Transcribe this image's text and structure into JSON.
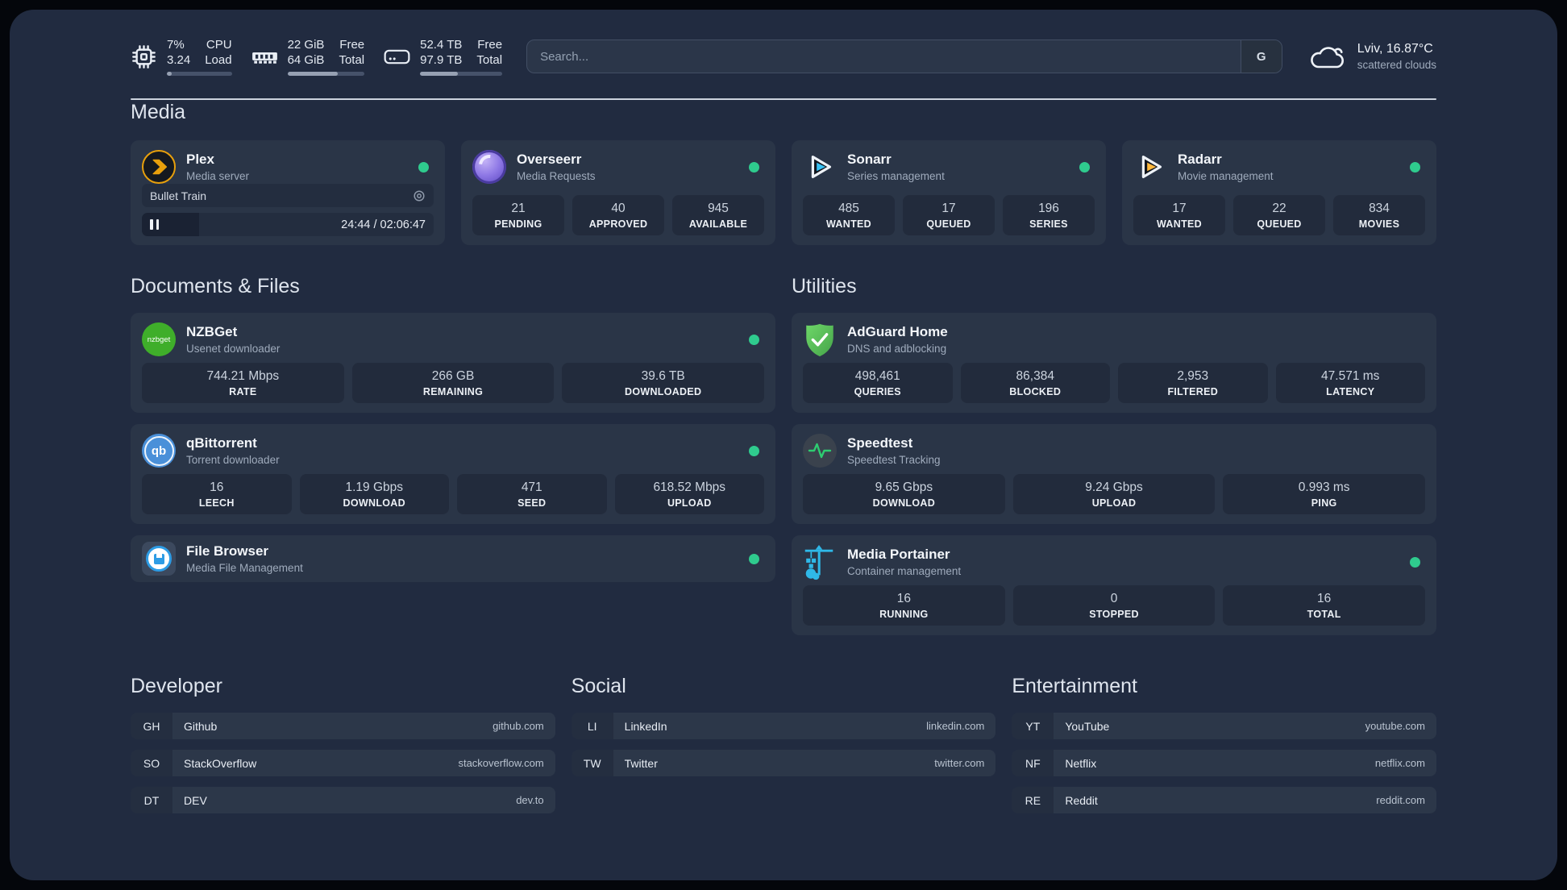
{
  "colors": {
    "panel_bg": "#212b40",
    "card_bg": "#2a3547",
    "stat_bg": "#222b3c",
    "status_online": "#2fcb8e",
    "plex_amber": "#e8a00c",
    "sonarr_blue": "#39c1f3",
    "radarr_yellow": "#ffb83d",
    "nzbget_green": "#3fae2a",
    "qbittorrent_blue": "#4a90d9",
    "adguard_green": "#5fce61",
    "portainer_blue": "#2fb8e8",
    "speedtest_pulse": "#2ecc71"
  },
  "topbar": {
    "cpu": {
      "value_top": "7%",
      "value_bottom": "3.24",
      "label_top": "CPU",
      "label_bottom": "Load",
      "bar_percent": 7
    },
    "memory": {
      "value_top": "22 GiB",
      "value_bottom": "64 GiB",
      "label_top": "Free",
      "label_bottom": "Total",
      "bar_percent": 65
    },
    "disk": {
      "value_top": "52.4 TB",
      "value_bottom": "97.9 TB",
      "label_top": "Free",
      "label_bottom": "Total",
      "bar_percent": 46
    },
    "search": {
      "placeholder": "Search...",
      "provider_label": "G"
    },
    "weather": {
      "location": "Lviv, 16.87°C",
      "condition": "scattered clouds"
    }
  },
  "sections": {
    "media": "Media",
    "documents": "Documents & Files",
    "utilities": "Utilities"
  },
  "apps": {
    "plex": {
      "name": "Plex",
      "desc": "Media server",
      "status": "online",
      "player": {
        "title": "Bullet Train",
        "time": "24:44 / 02:06:47",
        "progress_percent": 19.5
      }
    },
    "overseerr": {
      "name": "Overseerr",
      "desc": "Media Requests",
      "status": "online",
      "stats": [
        {
          "value": "21",
          "label": "PENDING"
        },
        {
          "value": "40",
          "label": "APPROVED"
        },
        {
          "value": "945",
          "label": "AVAILABLE"
        }
      ]
    },
    "sonarr": {
      "name": "Sonarr",
      "desc": "Series management",
      "status": "online",
      "stats": [
        {
          "value": "485",
          "label": "WANTED"
        },
        {
          "value": "17",
          "label": "QUEUED"
        },
        {
          "value": "196",
          "label": "SERIES"
        }
      ]
    },
    "radarr": {
      "name": "Radarr",
      "desc": "Movie management",
      "status": "online",
      "stats": [
        {
          "value": "17",
          "label": "WANTED"
        },
        {
          "value": "22",
          "label": "QUEUED"
        },
        {
          "value": "834",
          "label": "MOVIES"
        }
      ]
    },
    "nzbget": {
      "name": "NZBGet",
      "desc": "Usenet downloader",
      "status": "online",
      "icon_text": "nzbget",
      "stats": [
        {
          "value": "744.21 Mbps",
          "label": "RATE"
        },
        {
          "value": "266 GB",
          "label": "REMAINING"
        },
        {
          "value": "39.6 TB",
          "label": "DOWNLOADED"
        }
      ]
    },
    "qbittorrent": {
      "name": "qBittorrent",
      "desc": "Torrent downloader",
      "status": "online",
      "icon_text": "qb",
      "stats": [
        {
          "value": "16",
          "label": "LEECH"
        },
        {
          "value": "1.19 Gbps",
          "label": "DOWNLOAD"
        },
        {
          "value": "471",
          "label": "SEED"
        },
        {
          "value": "618.52 Mbps",
          "label": "UPLOAD"
        }
      ]
    },
    "filebrowser": {
      "name": "File Browser",
      "desc": "Media File Management",
      "status": "online"
    },
    "adguard": {
      "name": "AdGuard Home",
      "desc": "DNS and adblocking",
      "stats": [
        {
          "value": "498,461",
          "label": "QUERIES"
        },
        {
          "value": "86,384",
          "label": "BLOCKED"
        },
        {
          "value": "2,953",
          "label": "FILTERED"
        },
        {
          "value": "47.571 ms",
          "label": "LATENCY"
        }
      ]
    },
    "speedtest": {
      "name": "Speedtest",
      "desc": "Speedtest Tracking",
      "stats": [
        {
          "value": "9.65 Gbps",
          "label": "DOWNLOAD"
        },
        {
          "value": "9.24 Gbps",
          "label": "UPLOAD"
        },
        {
          "value": "0.993 ms",
          "label": "PING"
        }
      ]
    },
    "portainer": {
      "name": "Media Portainer",
      "desc": "Container management",
      "status": "online",
      "stats": [
        {
          "value": "16",
          "label": "RUNNING"
        },
        {
          "value": "0",
          "label": "STOPPED"
        },
        {
          "value": "16",
          "label": "TOTAL"
        }
      ]
    }
  },
  "bookmark_groups": [
    {
      "title": "Developer",
      "items": [
        {
          "abbr": "GH",
          "name": "Github",
          "url": "github.com"
        },
        {
          "abbr": "SO",
          "name": "StackOverflow",
          "url": "stackoverflow.com"
        },
        {
          "abbr": "DT",
          "name": "DEV",
          "url": "dev.to"
        }
      ]
    },
    {
      "title": "Social",
      "items": [
        {
          "abbr": "LI",
          "name": "LinkedIn",
          "url": "linkedin.com"
        },
        {
          "abbr": "TW",
          "name": "Twitter",
          "url": "twitter.com"
        }
      ]
    },
    {
      "title": "Entertainment",
      "items": [
        {
          "abbr": "YT",
          "name": "YouTube",
          "url": "youtube.com"
        },
        {
          "abbr": "NF",
          "name": "Netflix",
          "url": "netflix.com"
        },
        {
          "abbr": "RE",
          "name": "Reddit",
          "url": "reddit.com"
        }
      ]
    }
  ]
}
